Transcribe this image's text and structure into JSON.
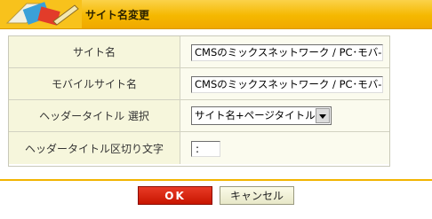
{
  "header": {
    "title": "サイト名変更"
  },
  "form": {
    "rows": [
      {
        "label": "サイト名",
        "value": "CMSのミックスネットワーク / PC･モバ-"
      },
      {
        "label": "モバイルサイト名",
        "value": "CMSのミックスネットワーク / PC･モバ-"
      },
      {
        "label": "ヘッダータイトル 選択",
        "value": "サイト名+ページタイトル"
      },
      {
        "label": "ヘッダータイトル区切り文字",
        "value": ":"
      }
    ]
  },
  "buttons": {
    "ok_label": "OK",
    "cancel_label": "キャンセル"
  },
  "colors": {
    "header": "#f5b800",
    "ok": "#c81600",
    "label_bg": "#f6f6dc"
  }
}
